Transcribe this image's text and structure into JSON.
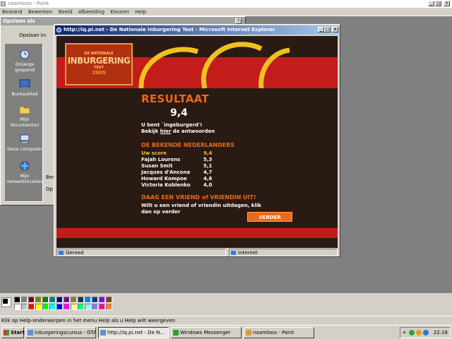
{
  "paint": {
    "title": "naamloos - Paint",
    "menu": [
      "Bestand",
      "Bewerken",
      "Beeld",
      "Afbeelding",
      "Kleuren",
      "Help"
    ],
    "status": "Klik op Help-onderwerpen in het menu Help als u Help wilt weergeven"
  },
  "saveas": {
    "title": "Opslaan als",
    "save_in_label": "Opslaan in:",
    "places": [
      "Onlangs geopend",
      "Bureaublad",
      "Mijn documenten",
      "Deze computer",
      "Mijn netwerklocaties"
    ],
    "partial_label_1": "Bes",
    "partial_label_2": "Op",
    "help_btn": "?"
  },
  "ie": {
    "title": "http://iq.pi.net - De Nationale Inburgering Test - Microsoft Internet Explorer",
    "status_left": "Gereed",
    "status_right": "Internet"
  },
  "page": {
    "logo": {
      "line1": "DE NATIONALE",
      "line2": "INBURGERING",
      "line3": "TEST",
      "line4": "2005"
    },
    "result_heading": "RESULTAAT",
    "score": "9,4",
    "line1": "U bent `ingeburgerd'!",
    "line2_pre": "Bekijk ",
    "line2_link": "hier",
    "line2_post": " de antwoorden",
    "famous_heading": "DE BEKENDE NEDERLANDERS",
    "famous": [
      {
        "name": "Uw score",
        "score": "9,4"
      },
      {
        "name": "Fajah Lourens",
        "score": "5,3"
      },
      {
        "name": "Susan Smit",
        "score": "5,1"
      },
      {
        "name": "Jacques d'Ancona",
        "score": "4,7"
      },
      {
        "name": "Howard Kompoe",
        "score": "4,6"
      },
      {
        "name": "Victoria Koblenko",
        "score": "4,0"
      }
    ],
    "invite_heading": "DAAG EEN VRIEND of VRIENDIN UIT!",
    "invite_line1": "Wilt u een vriend of vriendin uitdagen, klik",
    "invite_line2": "dan op verder",
    "verder_button": "VERDER"
  },
  "palette": [
    "#000000",
    "#808080",
    "#800000",
    "#808000",
    "#008000",
    "#008080",
    "#000080",
    "#800080",
    "#808040",
    "#004040",
    "#0080ff",
    "#004080",
    "#8000ff",
    "#804000",
    "#ffffff",
    "#c0c0c0",
    "#ff0000",
    "#ffff00",
    "#00ff00",
    "#00ffff",
    "#0000ff",
    "#ff00ff",
    "#ffff80",
    "#00ff80",
    "#80ffff",
    "#8080ff",
    "#ff0080",
    "#ff8040"
  ],
  "taskbar": {
    "start": "Start",
    "tasks": [
      "inburgeringscursus - GTA...",
      "http://iq.pi.net - De N...",
      "Windows Messenger",
      "naamloos - Paint"
    ],
    "active_index": 1,
    "clock": "22:18"
  }
}
